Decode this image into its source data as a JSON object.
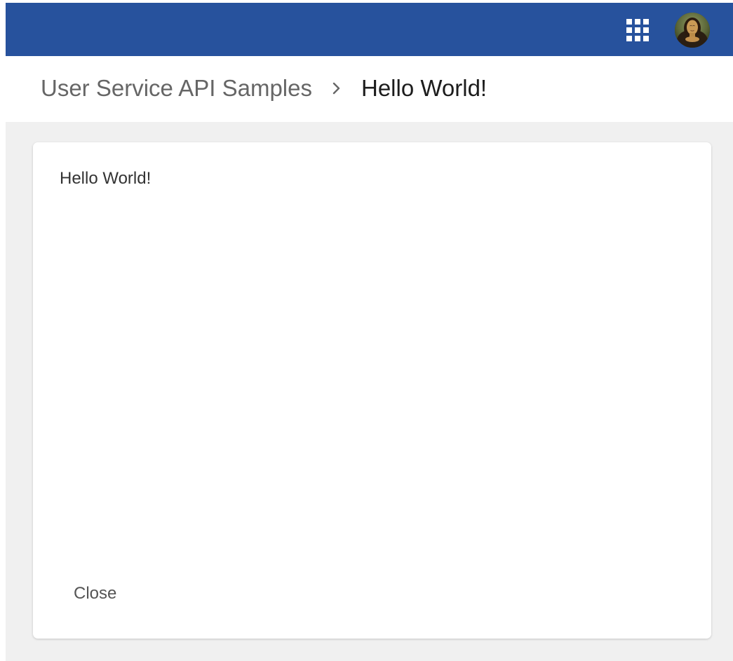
{
  "header": {
    "apps_icon": "apps-grid-icon",
    "avatar_icon": "user-avatar"
  },
  "breadcrumb": {
    "parent": "User Service API Samples",
    "separator_icon": "chevron-right-icon",
    "current": "Hello World!"
  },
  "card": {
    "message": "Hello World!",
    "close_label": "Close"
  },
  "colors": {
    "topbar": "#27529d",
    "page_background": "#f0f0f0",
    "card_background": "#ffffff"
  }
}
